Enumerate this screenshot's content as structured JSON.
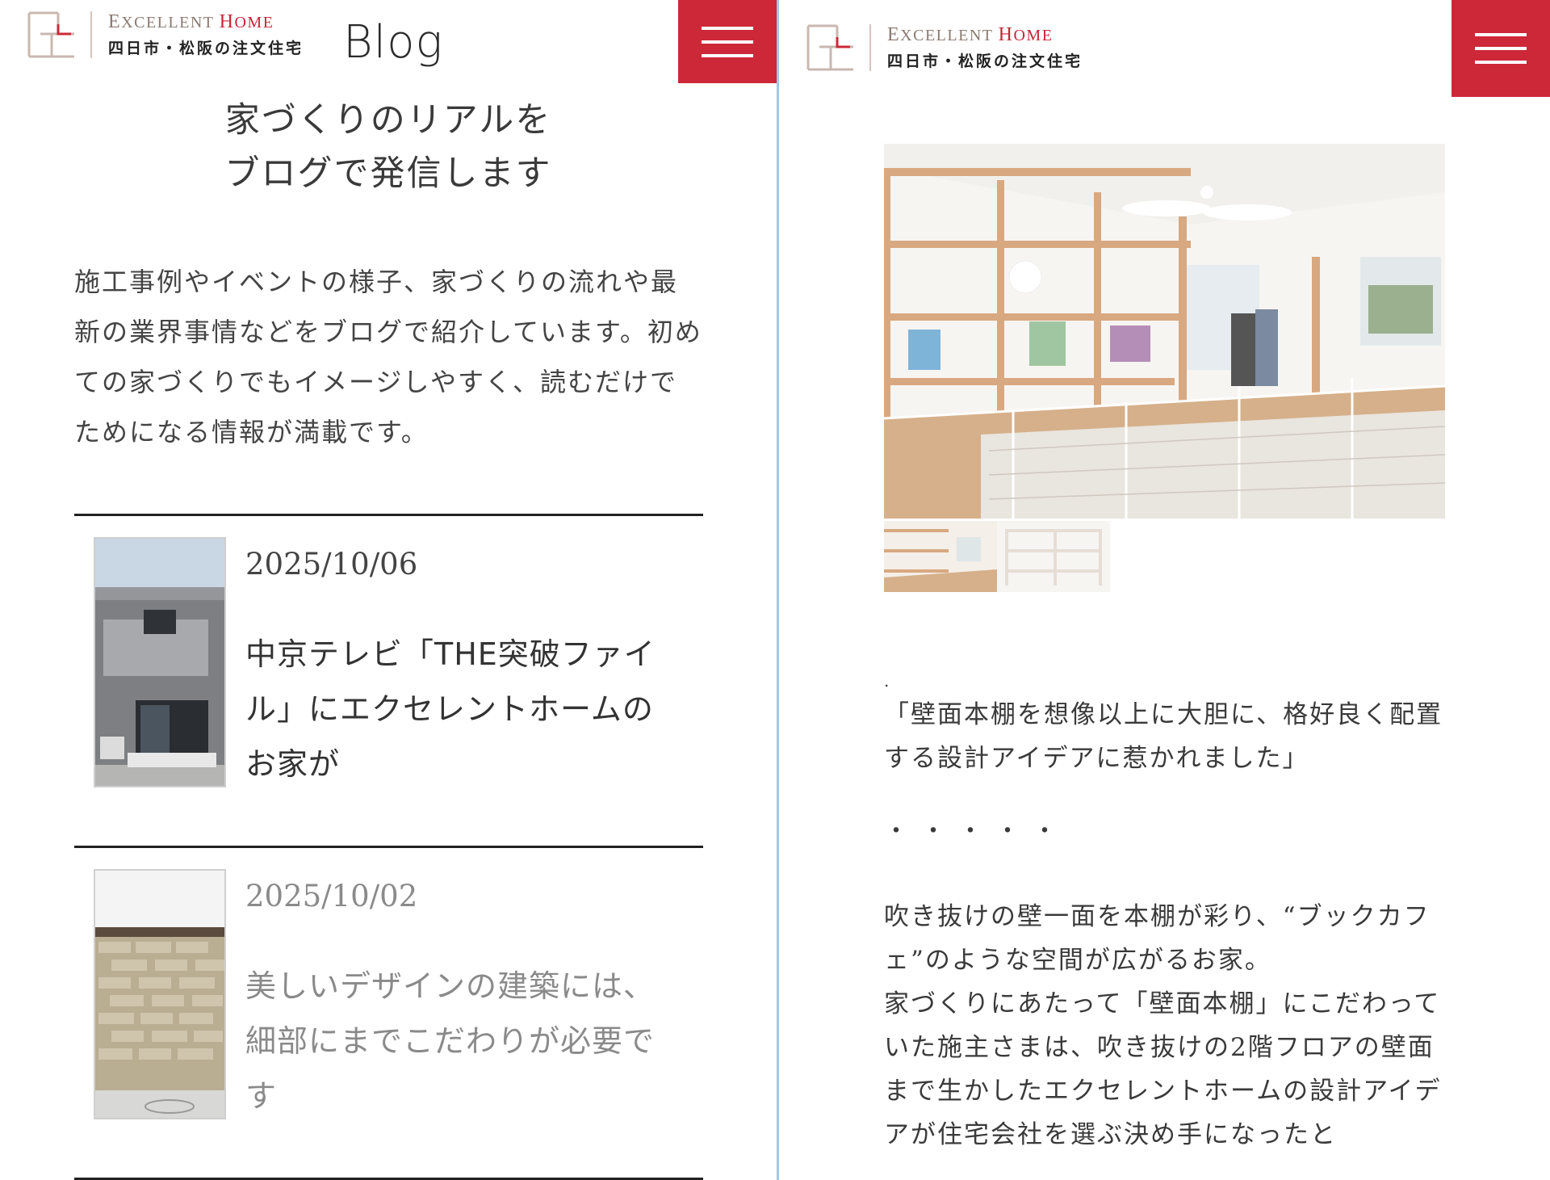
{
  "brand": {
    "name_cap1": "E",
    "name_rest1": "XCELLENT ",
    "name_cap2": "H",
    "name_rest2": "OME",
    "tagline": "四日市・松阪の注文住宅",
    "accent_color": "#cc2838"
  },
  "left": {
    "page_title": "Blog",
    "headline_line1": "家づくりのリアルを",
    "headline_line2": "ブログで発信します",
    "intro": "施工事例やイベントの様子、家づくりの流れや最新の業界事情などをブログで紹介しています。初めての家づくりでもイメージしやすく、読むだけでためになる情報が満載です。",
    "posts": [
      {
        "date": "2025/10/06",
        "title": "中京テレビ「THE突破ファイル」にエクセレントホームのお家が",
        "thumb_icon": "gray-house-photo"
      },
      {
        "date": "2025/10/02",
        "title": "美しいデザインの建築には、細部にまでこだわりが必要です",
        "thumb_icon": "brick-wall-photo"
      }
    ]
  },
  "right": {
    "hero_icon": "bookshelf-loft-photo",
    "gallery_thumbs": [
      "loft-thumb-1",
      "loft-thumb-2"
    ],
    "article": {
      "dot": ".",
      "quote": "「壁面本棚を想像以上に大胆に、格好良く配置する設計アイデアに惹かれました」",
      "dots": "・・・・・",
      "body": "吹き抜けの壁一面を本棚が彩り、“ブックカフェ”のような空間が広がるお家。\n家づくりにあたって「壁面本棚」にこだわっていた施主さまは、吹き抜けの2階フロアの壁面まで生かしたエクセレントホームの設計アイデアが住宅会社を選ぶ決め手になったと"
    }
  }
}
